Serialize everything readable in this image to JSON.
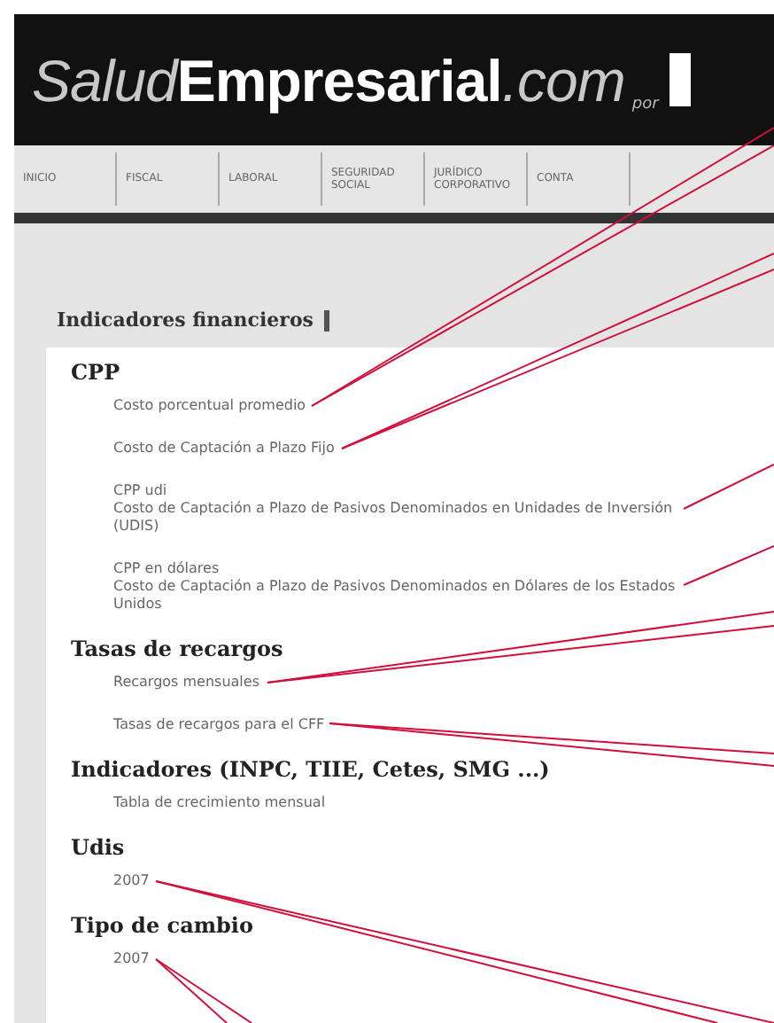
{
  "header": {
    "logo_light": "Salud",
    "logo_bold": "Empresarial",
    "logo_domain": ".com",
    "by": "por"
  },
  "nav": [
    {
      "label": "INICIO"
    },
    {
      "label": "FISCAL"
    },
    {
      "label": "LABORAL"
    },
    {
      "label": "SEGURIDAD SOCIAL"
    },
    {
      "label": "JURÍDICO CORPORATIVO"
    },
    {
      "label": "CONTA"
    }
  ],
  "section_title": "Indicadores financieros",
  "groups": [
    {
      "heading": "CPP",
      "links": [
        {
          "title": "Costo porcentual promedio"
        },
        {
          "title": "Costo de Captación a Plazo Fijo"
        },
        {
          "title": "CPP udi",
          "text": "Costo de Captación a Plazo de Pasivos Denominados en Unidades de Inversión (UDIS)"
        },
        {
          "title": "CPP en dólares",
          "text": "Costo de Captación a Plazo de Pasivos Denominados en Dólares de los Estados Unidos"
        }
      ]
    },
    {
      "heading": "Tasas de recargos",
      "links": [
        {
          "title": "Recargos mensuales"
        },
        {
          "title": "Tasas de recargos para el CFF"
        }
      ]
    },
    {
      "heading": "Indicadores (INPC, TIIE, Cetes, SMG ...)",
      "links": [
        {
          "title": "Tabla de crecimiento mensual"
        }
      ]
    },
    {
      "heading": "Udis",
      "links": [
        {
          "title": "2007"
        }
      ]
    },
    {
      "heading": "Tipo de cambio",
      "links": [
        {
          "title": "2007"
        }
      ]
    }
  ]
}
